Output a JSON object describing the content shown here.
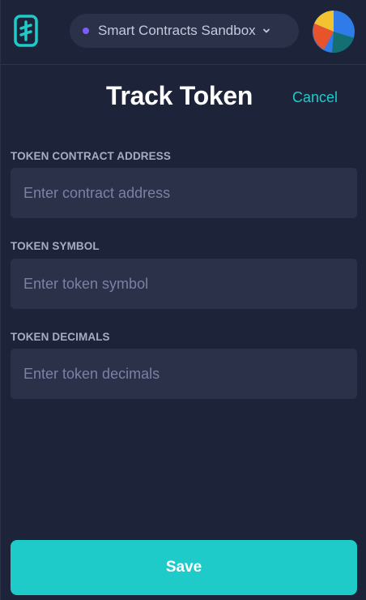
{
  "header": {
    "logo_icon": "thirdweb-logo-icon",
    "network": {
      "label": "Smart Contracts Sandbox",
      "dot_color": "#7b5cff",
      "dropdown_icon": "chevron-down-icon"
    },
    "avatar_colors": [
      "#2f7be8",
      "#f2c230",
      "#e9532b",
      "#146f73"
    ]
  },
  "page": {
    "title": "Track Token",
    "cancel_label": "Cancel"
  },
  "form": {
    "fields": [
      {
        "label": "TOKEN CONTRACT ADDRESS",
        "placeholder": "Enter contract address",
        "value": ""
      },
      {
        "label": "TOKEN SYMBOL",
        "placeholder": "Enter token symbol",
        "value": ""
      },
      {
        "label": "TOKEN DECIMALS",
        "placeholder": "Enter token decimals",
        "value": ""
      }
    ]
  },
  "actions": {
    "save_label": "Save"
  },
  "colors": {
    "background": "#1d2439",
    "surface": "#2b3149",
    "accent": "#1ecbc9",
    "label": "#a6abc6",
    "placeholder": "#7b81a3"
  }
}
